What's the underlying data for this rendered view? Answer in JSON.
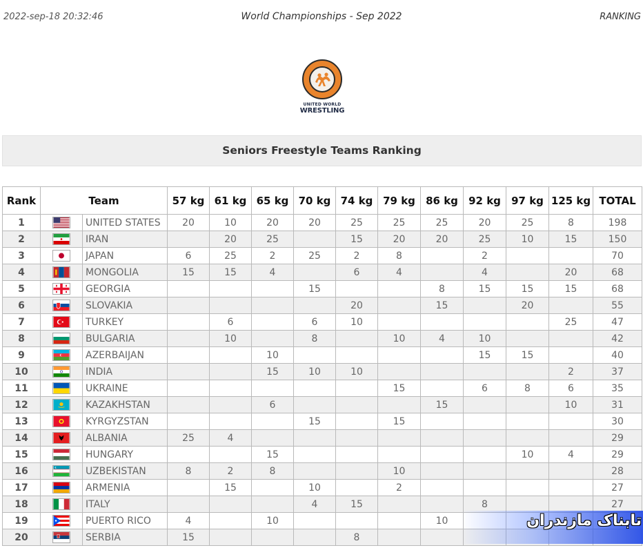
{
  "header": {
    "timestamp": "2022-sep-18 20:32:46",
    "event": "World Championships - Sep 2022",
    "section": "RANKING"
  },
  "logo": {
    "line1": "UNITED WORLD",
    "line2": "WRESTLING",
    "colors": {
      "ring": "#e9842c",
      "outline": "#2a2a2a",
      "text": "#1f2a44"
    }
  },
  "title": "Seniors Freestyle Teams Ranking",
  "table": {
    "columns": [
      "Rank",
      "Team",
      "57 kg",
      "61 kg",
      "65 kg",
      "70 kg",
      "74 kg",
      "79 kg",
      "86 kg",
      "92 kg",
      "97 kg",
      "125 kg",
      "TOTAL"
    ],
    "rows": [
      {
        "rank": "1",
        "flag": "usa-flag-icon",
        "team": "UNITED STATES",
        "scores": [
          "20",
          "10",
          "20",
          "20",
          "25",
          "25",
          "25",
          "20",
          "25",
          "8"
        ],
        "total": "198"
      },
      {
        "rank": "2",
        "flag": "iran-flag-icon",
        "team": "IRAN",
        "scores": [
          "",
          "20",
          "25",
          "",
          "15",
          "20",
          "20",
          "25",
          "10",
          "15"
        ],
        "total": "150"
      },
      {
        "rank": "3",
        "flag": "japan-flag-icon",
        "team": "JAPAN",
        "scores": [
          "6",
          "25",
          "2",
          "25",
          "2",
          "8",
          "",
          "2",
          "",
          ""
        ],
        "total": "70"
      },
      {
        "rank": "4",
        "flag": "mongolia-flag-icon",
        "team": "MONGOLIA",
        "scores": [
          "15",
          "15",
          "4",
          "",
          "6",
          "4",
          "",
          "4",
          "",
          "20"
        ],
        "total": "68"
      },
      {
        "rank": "5",
        "flag": "georgia-flag-icon",
        "team": "GEORGIA",
        "scores": [
          "",
          "",
          "",
          "15",
          "",
          "",
          "8",
          "15",
          "15",
          "15"
        ],
        "total": "68"
      },
      {
        "rank": "6",
        "flag": "slovakia-flag-icon",
        "team": "SLOVAKIA",
        "scores": [
          "",
          "",
          "",
          "",
          "20",
          "",
          "15",
          "",
          "20",
          ""
        ],
        "total": "55"
      },
      {
        "rank": "7",
        "flag": "turkey-flag-icon",
        "team": "TURKEY",
        "scores": [
          "",
          "6",
          "",
          "6",
          "10",
          "",
          "",
          "",
          "",
          "25"
        ],
        "total": "47"
      },
      {
        "rank": "8",
        "flag": "bulgaria-flag-icon",
        "team": "BULGARIA",
        "scores": [
          "",
          "10",
          "",
          "8",
          "",
          "10",
          "4",
          "10",
          "",
          ""
        ],
        "total": "42"
      },
      {
        "rank": "9",
        "flag": "azerbaijan-flag-icon",
        "team": "AZERBAIJAN",
        "scores": [
          "",
          "",
          "10",
          "",
          "",
          "",
          "",
          "15",
          "15",
          ""
        ],
        "total": "40"
      },
      {
        "rank": "10",
        "flag": "india-flag-icon",
        "team": "INDIA",
        "scores": [
          "",
          "",
          "15",
          "10",
          "10",
          "",
          "",
          "",
          "",
          "2"
        ],
        "total": "37"
      },
      {
        "rank": "11",
        "flag": "ukraine-flag-icon",
        "team": "UKRAINE",
        "scores": [
          "",
          "",
          "",
          "",
          "",
          "15",
          "",
          "6",
          "8",
          "6"
        ],
        "total": "35"
      },
      {
        "rank": "12",
        "flag": "kazakhstan-flag-icon",
        "team": "KAZAKHSTAN",
        "scores": [
          "",
          "",
          "6",
          "",
          "",
          "",
          "15",
          "",
          "",
          "10"
        ],
        "total": "31"
      },
      {
        "rank": "13",
        "flag": "kyrgyzstan-flag-icon",
        "team": "KYRGYZSTAN",
        "scores": [
          "",
          "",
          "",
          "15",
          "",
          "15",
          "",
          "",
          "",
          ""
        ],
        "total": "30"
      },
      {
        "rank": "14",
        "flag": "albania-flag-icon",
        "team": "ALBANIA",
        "scores": [
          "25",
          "4",
          "",
          "",
          "",
          "",
          "",
          "",
          "",
          ""
        ],
        "total": "29"
      },
      {
        "rank": "15",
        "flag": "hungary-flag-icon",
        "team": "HUNGARY",
        "scores": [
          "",
          "",
          "15",
          "",
          "",
          "",
          "",
          "",
          "10",
          "4"
        ],
        "total": "29"
      },
      {
        "rank": "16",
        "flag": "uzbekistan-flag-icon",
        "team": "UZBEKISTAN",
        "scores": [
          "8",
          "2",
          "8",
          "",
          "",
          "10",
          "",
          "",
          "",
          ""
        ],
        "total": "28"
      },
      {
        "rank": "17",
        "flag": "armenia-flag-icon",
        "team": "ARMENIA",
        "scores": [
          "",
          "15",
          "",
          "10",
          "",
          "2",
          "",
          "",
          "",
          ""
        ],
        "total": "27"
      },
      {
        "rank": "18",
        "flag": "italy-flag-icon",
        "team": "ITALY",
        "scores": [
          "",
          "",
          "",
          "4",
          "15",
          "",
          "",
          "8",
          "",
          ""
        ],
        "total": "27"
      },
      {
        "rank": "19",
        "flag": "puerto-rico-flag-icon",
        "team": "PUERTO RICO",
        "scores": [
          "4",
          "",
          "10",
          "",
          "",
          "",
          "10",
          "",
          "",
          ""
        ],
        "total": ""
      },
      {
        "rank": "20",
        "flag": "serbia-flag-icon",
        "team": "SERBIA",
        "scores": [
          "15",
          "",
          "",
          "",
          "8",
          "",
          "",
          "",
          "",
          ""
        ],
        "total": ""
      }
    ]
  },
  "watermark": {
    "text": "تابناک مازندران"
  }
}
